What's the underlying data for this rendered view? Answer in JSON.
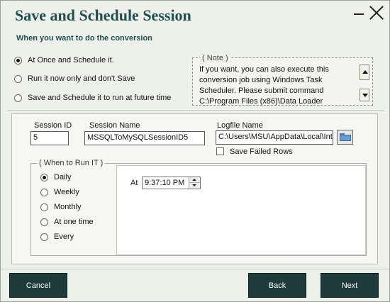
{
  "window": {
    "title": "Save and Schedule Session",
    "subtitle": "When you want to do the conversion"
  },
  "run_options": [
    {
      "label": "At Once and Schedule it.",
      "selected": true
    },
    {
      "label": "Run it now only and don't Save",
      "selected": false
    },
    {
      "label": "Save and Schedule it to run at future time",
      "selected": false
    }
  ],
  "note": {
    "legend": "( Note )",
    "lines": [
      "If you want, you can also execute this",
      "conversion job using Windows Task",
      "Scheduler. Please submit command",
      "C:\\Program Files (x86)\\Data Loader"
    ]
  },
  "session": {
    "id_label": "Session ID",
    "id_value": "5",
    "name_label": "Session Name",
    "name_value": "MSSQLToMySQLSessionID5",
    "logfile_label": "Logfile Name",
    "logfile_value": "C:\\Users\\MSU\\AppData\\Local\\Inte",
    "save_failed_rows_label": "Save Failed Rows",
    "save_failed_rows_checked": false
  },
  "schedule": {
    "legend": "( When to Run IT )",
    "options": [
      {
        "label": "Daily",
        "selected": true
      },
      {
        "label": "Weekly",
        "selected": false
      },
      {
        "label": "Monthly",
        "selected": false
      },
      {
        "label": "At one time",
        "selected": false
      },
      {
        "label": "Every",
        "selected": false
      }
    ],
    "at_label": "At",
    "time_value": "9:37:10 PM"
  },
  "buttons": {
    "cancel": "Cancel",
    "back": "Back",
    "next": "Next"
  }
}
